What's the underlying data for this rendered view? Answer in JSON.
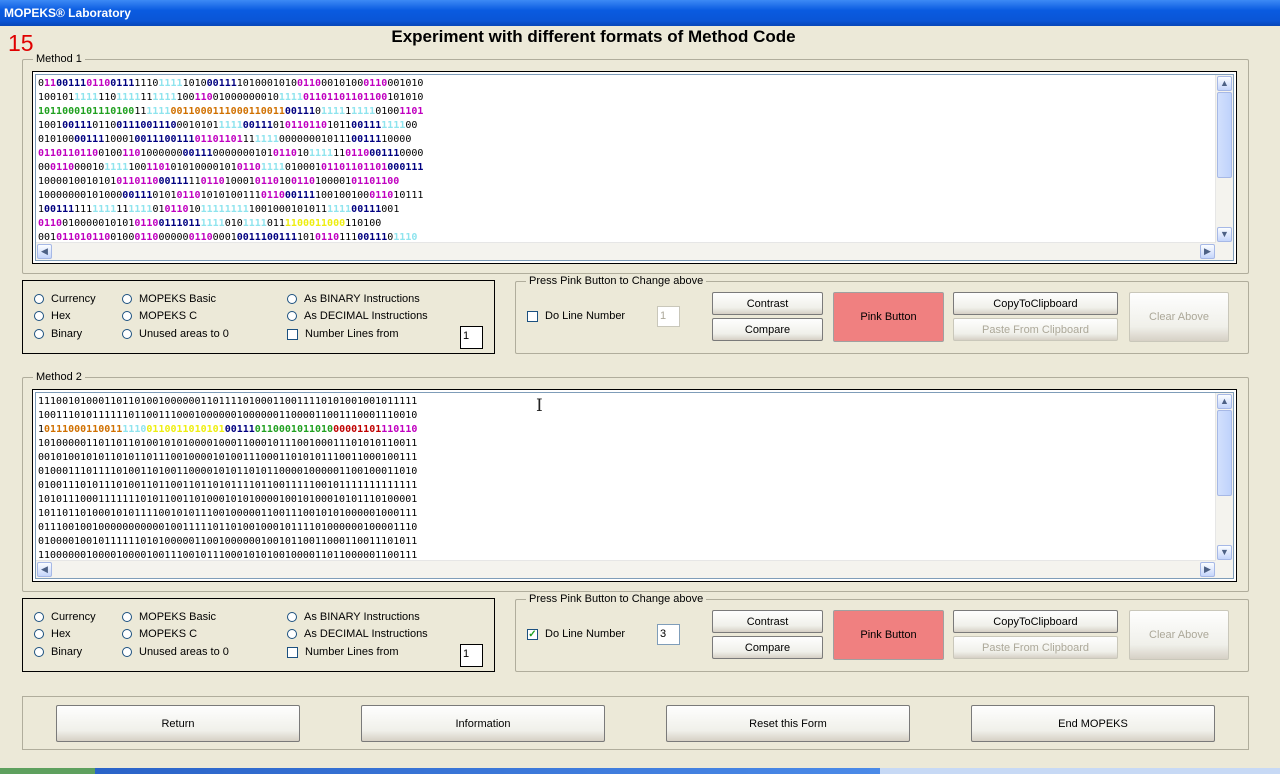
{
  "window": {
    "title": "MOPEKS® Laboratory"
  },
  "experiment_number": "15",
  "main_title": "Experiment with different formats of Method Code",
  "methods": [
    {
      "title": "Method 1",
      "lines": [
        [
          [
            "",
            "0"
          ],
          [
            "p",
            "11"
          ],
          [
            "b",
            "00111"
          ],
          [
            "p",
            "0110"
          ],
          [
            "b",
            "0111"
          ],
          [
            "",
            "1110"
          ],
          [
            "c",
            "1111"
          ],
          [
            "",
            "1010"
          ],
          [
            "b",
            "00111"
          ],
          [
            "",
            "1010001010"
          ],
          [
            "p",
            "0110"
          ],
          [
            "",
            "0010100"
          ],
          [
            "p",
            "0110"
          ],
          [
            "",
            "001010"
          ]
        ],
        [
          [
            "",
            "100101"
          ],
          [
            "c",
            "1111"
          ],
          [
            "",
            "110"
          ],
          [
            "c",
            "1111"
          ],
          [
            "",
            "11"
          ],
          [
            "c",
            "1111"
          ],
          [
            "",
            "100"
          ],
          [
            "p",
            "110"
          ],
          [
            "",
            "01000000010"
          ],
          [
            "c",
            "1111"
          ],
          [
            "p",
            "01101101101100"
          ],
          [
            "",
            "101010"
          ]
        ],
        [
          [
            "g",
            "1011000101110100"
          ],
          [
            "",
            "11"
          ],
          [
            "c",
            "1111"
          ],
          [
            "o",
            "0011000111000110011"
          ],
          [
            "b",
            "00111"
          ],
          [
            "",
            "0"
          ],
          [
            "c",
            "1111"
          ],
          [
            "",
            "1"
          ],
          [
            "c",
            "1111"
          ],
          [
            "",
            "0100"
          ],
          [
            "p",
            "1101"
          ]
        ],
        [
          [
            "",
            "1001"
          ],
          [
            "b",
            "00111"
          ],
          [
            "",
            "0110"
          ],
          [
            "b",
            "0111001110"
          ],
          [
            "",
            "0010101"
          ],
          [
            "c",
            "1111"
          ],
          [
            "b",
            "00111"
          ],
          [
            "",
            "01"
          ],
          [
            "p",
            "0110110"
          ],
          [
            "",
            "1011"
          ],
          [
            "b",
            "00111"
          ],
          [
            "c",
            "1111"
          ],
          [
            "",
            "00"
          ]
        ],
        [
          [
            "",
            "010100"
          ],
          [
            "b",
            "00111"
          ],
          [
            "",
            "10001"
          ],
          [
            "b",
            "0011100111"
          ],
          [
            "p",
            "01101101"
          ],
          [
            "",
            "11"
          ],
          [
            "c",
            "1111"
          ],
          [
            "",
            "000000010111"
          ],
          [
            "b",
            "00111"
          ],
          [
            "",
            "10000"
          ]
        ],
        [
          [
            "p",
            "0110110110"
          ],
          [
            "",
            "0100"
          ],
          [
            "p",
            "110"
          ],
          [
            "",
            "1000000"
          ],
          [
            "b",
            "00111"
          ],
          [
            "",
            "0000000101"
          ],
          [
            "p",
            "0110"
          ],
          [
            "",
            "10"
          ],
          [
            "c",
            "1111"
          ],
          [
            "",
            "11"
          ],
          [
            "p",
            "0110"
          ],
          [
            "b",
            "00111"
          ],
          [
            "",
            "0000"
          ]
        ],
        [
          [
            "",
            "00"
          ],
          [
            "p",
            "0110"
          ],
          [
            "",
            "00010"
          ],
          [
            "c",
            "1111"
          ],
          [
            "",
            "100"
          ],
          [
            "p",
            "1101"
          ],
          [
            "",
            "01010000101"
          ],
          [
            "p",
            "0110"
          ],
          [
            "c",
            "1111"
          ],
          [
            "",
            "010001"
          ],
          [
            "p",
            "01101101101"
          ],
          [
            "b",
            "000111"
          ]
        ],
        [
          [
            "",
            "1000010010101"
          ],
          [
            "p",
            "0110110"
          ],
          [
            "b",
            "00111"
          ],
          [
            "",
            "11"
          ],
          [
            "p",
            "0110"
          ],
          [
            "",
            "10001"
          ],
          [
            "p",
            "0110"
          ],
          [
            "",
            "10"
          ],
          [
            "p",
            "0110"
          ],
          [
            "",
            "100001"
          ],
          [
            "p",
            "01101"
          ],
          [
            "p",
            "100"
          ]
        ],
        [
          [
            "",
            "10000000101000"
          ],
          [
            "b",
            "00111"
          ],
          [
            "",
            "0101"
          ],
          [
            "p",
            "0110"
          ],
          [
            "",
            "1010100111"
          ],
          [
            "p",
            "0110"
          ],
          [
            "b",
            "00111"
          ],
          [
            "",
            "100100100"
          ],
          [
            "p",
            "0110"
          ],
          [
            "",
            "10111"
          ]
        ],
        [
          [
            "",
            "1"
          ],
          [
            "b",
            "00111"
          ],
          [
            "",
            "111"
          ],
          [
            "c",
            "1111"
          ],
          [
            "",
            "11"
          ],
          [
            "c",
            "1111"
          ],
          [
            "",
            "01"
          ],
          [
            "p",
            "0110"
          ],
          [
            "",
            "10"
          ],
          [
            "c",
            "11111111"
          ],
          [
            "",
            "1001000101011"
          ],
          [
            "c",
            "1111"
          ],
          [
            "b",
            "00111"
          ],
          [
            "",
            "001"
          ]
        ],
        [
          [
            "p",
            "0110"
          ],
          [
            "",
            "010000010101"
          ],
          [
            "p",
            "0110"
          ],
          [
            "b",
            "0111011"
          ],
          [
            "c",
            "1111"
          ],
          [
            "",
            "010"
          ],
          [
            "c",
            "1111"
          ],
          [
            "",
            "011"
          ],
          [
            "y",
            "1100011000"
          ],
          [
            "",
            "110100"
          ]
        ],
        [
          [
            "",
            "001"
          ],
          [
            "p",
            "01101"
          ],
          [
            "p",
            "0110"
          ],
          [
            "",
            "0100"
          ],
          [
            "p",
            "0110"
          ],
          [
            "",
            "00000"
          ],
          [
            "p",
            "0110"
          ],
          [
            "",
            "0001"
          ],
          [
            "b",
            "00111"
          ],
          [
            "b",
            "00111"
          ],
          [
            "",
            "101"
          ],
          [
            "p",
            "0110"
          ],
          [
            "",
            "111"
          ],
          [
            "b",
            "00111"
          ],
          [
            "",
            "0"
          ],
          [
            "c",
            "1110"
          ]
        ]
      ],
      "options": {
        "radios": [
          "Currency",
          "Hex",
          "Binary",
          "MOPEKS Basic",
          "MOPEKS C",
          "Unused areas to 0",
          "As BINARY Instructions",
          "As DECIMAL Instructions"
        ],
        "number_lines_label": "Number Lines  from",
        "number_lines_from": "1"
      },
      "controls": {
        "title": "Press Pink Button to Change above",
        "do_line_label": "Do Line Number",
        "do_line_checked": false,
        "do_line_value": "1",
        "contrast": "Contrast",
        "compare": "Compare",
        "pink": "Pink Button",
        "copy": "CopyToClipboard",
        "paste": "Paste From Clipboard",
        "clear": "Clear Above"
      }
    },
    {
      "title": "Method 2",
      "lines": [
        [
          [
            "",
            "111001010001101101001000000110111101000110011110101001001011111"
          ]
        ],
        [
          [
            "",
            "100111010111111011001110001000000100000011000011001110001110010"
          ]
        ],
        [
          [
            "",
            "1"
          ],
          [
            "o",
            "0111000110011"
          ],
          [
            "c",
            "1110"
          ],
          [
            "y",
            "0110011010101"
          ],
          [
            "b",
            "00111"
          ],
          [
            "g",
            "0110001011010"
          ],
          [
            "r",
            "00001101"
          ],
          [
            "p",
            "1101"
          ],
          [
            "p",
            "10"
          ]
        ],
        [
          [
            "",
            "101000001101101101001010100001000110001011100100011101010110011"
          ]
        ],
        [
          [
            "",
            "001010010101101011011100100001010011100011010101110011000100111"
          ]
        ],
        [
          [
            "",
            "010001110111101001101001100001010110101100001000001100100011010"
          ]
        ],
        [
          [
            "",
            "010011101011101001101100110110101111011001111100101111111111111"
          ]
        ],
        [
          [
            "",
            "101011100011111110101100110100010101000010010100010101110100001"
          ]
        ],
        [
          [
            "",
            "101101101000101011110010101110010000011001110010101000001000111"
          ]
        ],
        [
          [
            "",
            "011100100100000000000100111110110100100010111101000000100001110"
          ]
        ],
        [
          [
            "",
            "010000100101111110101000001100100000010010110011000110011101011"
          ]
        ],
        [
          [
            "",
            "110000001000010000100111001011100010101001000011011000001100111"
          ]
        ]
      ],
      "options": {
        "radios": [
          "Currency",
          "Hex",
          "Binary",
          "MOPEKS Basic",
          "MOPEKS C",
          "Unused areas to 0",
          "As BINARY Instructions",
          "As DECIMAL Instructions"
        ],
        "number_lines_label": "Number Lines  from",
        "number_lines_from": "1"
      },
      "controls": {
        "title": "Press Pink Button to Change above",
        "do_line_label": "Do Line Number",
        "do_line_checked": true,
        "do_line_value": "3",
        "contrast": "Contrast",
        "compare": "Compare",
        "pink": "Pink Button",
        "copy": "CopyToClipboard",
        "paste": "Paste From Clipboard",
        "clear": "Clear Above"
      }
    }
  ],
  "footer_buttons": [
    "Return",
    "Information",
    "Reset this Form",
    "End MOPEKS"
  ],
  "colors": {
    "pink_button": "#f08080",
    "experiment_number": "#e00000",
    "magenta": "#c000c0",
    "navy": "#000080",
    "cyan": "#8fe4ee",
    "green": "#20a020",
    "orange": "#d07000",
    "yellow": "#eeee10",
    "red": "#c00000"
  }
}
